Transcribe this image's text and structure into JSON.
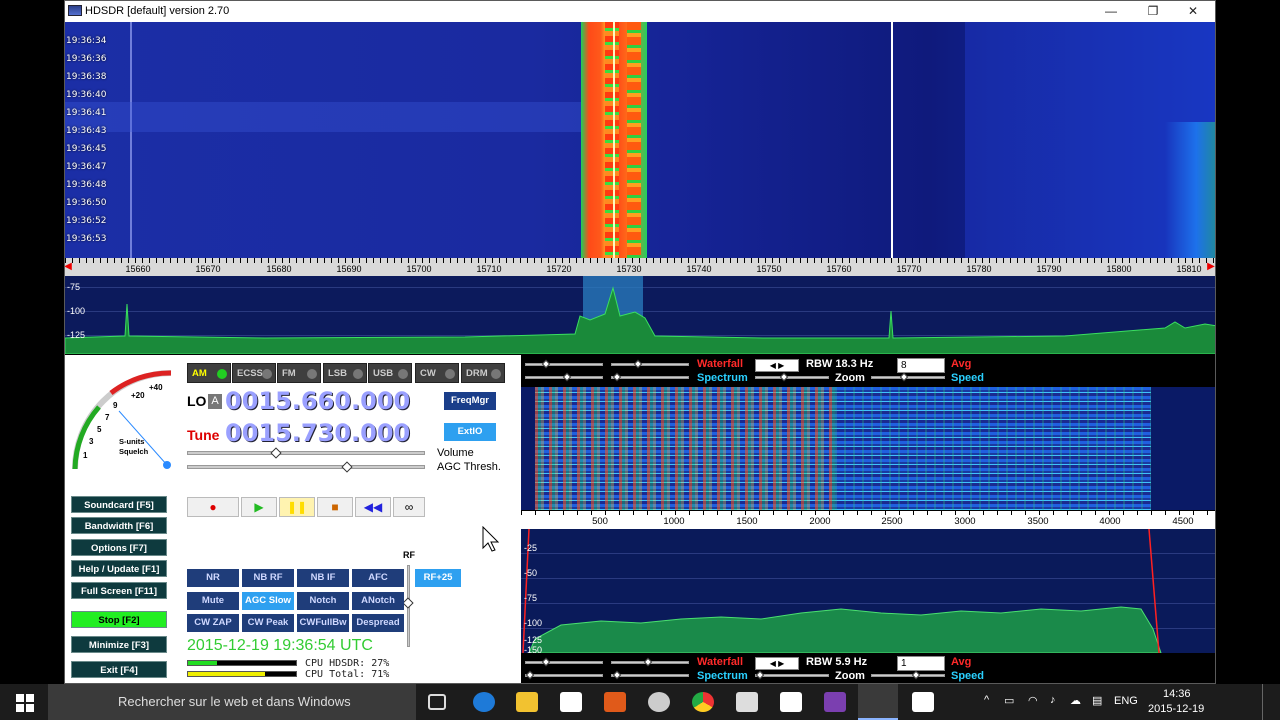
{
  "window": {
    "title": "HDSDR [default]  version 2.70",
    "minimize": "—",
    "maximize": "❐",
    "close": "✕"
  },
  "timestamps": [
    "19:36:34",
    "19:36:36",
    "19:36:38",
    "19:36:40",
    "19:36:41",
    "19:36:43",
    "19:36:45",
    "19:36:47",
    "19:36:48",
    "19:36:50",
    "19:36:52",
    "19:36:53"
  ],
  "rf_ruler": [
    "15660",
    "15670",
    "15680",
    "15690",
    "15700",
    "15710",
    "15720",
    "15730",
    "15740",
    "15750",
    "15760",
    "15770",
    "15780",
    "15790",
    "15800",
    "15810"
  ],
  "rf_levels": [
    "-75",
    "-100",
    "-125"
  ],
  "modes": [
    {
      "label": "AM",
      "active": true
    },
    {
      "label": "ECSS",
      "active": false
    },
    {
      "label": "FM",
      "active": false
    },
    {
      "label": "LSB",
      "active": false
    },
    {
      "label": "USB",
      "active": false
    },
    {
      "label": "CW",
      "active": false
    },
    {
      "label": "DRM",
      "active": false
    }
  ],
  "lo": {
    "label": "LO",
    "badge": "A",
    "value": "0015.660.000"
  },
  "tune": {
    "label": "Tune",
    "value": "0015.730.000"
  },
  "freqmgr": "FreqMgr",
  "extio": "ExtIO",
  "volume_label": "Volume",
  "agc_label": "AGC Thresh.",
  "smeter": {
    "scale": [
      "+40",
      "+20",
      "9",
      "7",
      "5",
      "3",
      "1"
    ],
    "label1": "S-units",
    "label2": "Squelch"
  },
  "menu": [
    {
      "label": "Soundcard",
      "key": "[F5]"
    },
    {
      "label": "Bandwidth",
      "key": "[F6]"
    },
    {
      "label": "Options",
      "key": "[F7]"
    },
    {
      "label": "Help / Update",
      "key": "[F1]"
    },
    {
      "label": "Full Screen",
      "key": "[F11]"
    },
    {
      "label": "Stop",
      "key": "[F2]"
    },
    {
      "label": "Minimize",
      "key": "[F3]"
    },
    {
      "label": "Exit",
      "key": "[F4]"
    }
  ],
  "transport": [
    "●",
    "▶",
    "❚❚",
    "■",
    "◀◀",
    "∞"
  ],
  "rf_label": "RF",
  "dsp": [
    [
      "NR",
      "NB RF",
      "NB IF",
      "AFC"
    ],
    [
      "Mute",
      "AGC Slow",
      "Notch",
      "ANotch"
    ],
    [
      "CW ZAP",
      "CW Peak",
      "CWFullBw",
      "Despread"
    ]
  ],
  "rf25": "RF+25",
  "datetime": "2015-12-19   19:36:54 UTC",
  "cpu": {
    "hdsdr": "CPU HDSDR:  27%",
    "total": "CPU Total:  71%",
    "hdsdr_value": 27,
    "total_value": 71
  },
  "controls_top": {
    "waterfall": "Waterfall",
    "spectrum": "Spectrum",
    "rbw": "RBW 18.3 Hz",
    "zoom": "Zoom",
    "avg_value": "8",
    "avg": "Avg",
    "speed": "Speed"
  },
  "controls_bottom": {
    "waterfall": "Waterfall",
    "spectrum": "Spectrum",
    "rbw": "RBW   5.9 Hz",
    "zoom": "Zoom",
    "avg_value": "1",
    "avg": "Avg",
    "speed": "Speed"
  },
  "audio_ruler": [
    "500",
    "1000",
    "1500",
    "2000",
    "2500",
    "3000",
    "3500",
    "4000",
    "4500"
  ],
  "audio_levels": [
    "-25",
    "-50",
    "-75",
    "-100",
    "-125",
    "-150"
  ],
  "taskbar": {
    "search": "Rechercher sur le web et dans Windows",
    "lang": "ENG",
    "time": "14:36",
    "date": "2015-12-19"
  }
}
